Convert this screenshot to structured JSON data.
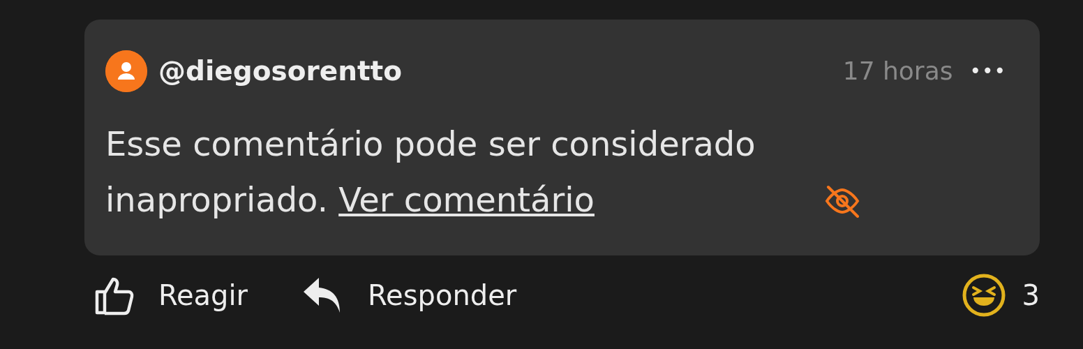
{
  "comment": {
    "author": "@diegosorentto",
    "time": "17 horas",
    "more": "•••",
    "message": "Esse comentário pode ser considerado inapropriado.",
    "link": "Ver comentário"
  },
  "actions": [
    {
      "label": "Reagir",
      "kind": "react"
    },
    {
      "label": "Responder",
      "kind": "reply"
    }
  ],
  "reactions": {
    "count": "3"
  }
}
